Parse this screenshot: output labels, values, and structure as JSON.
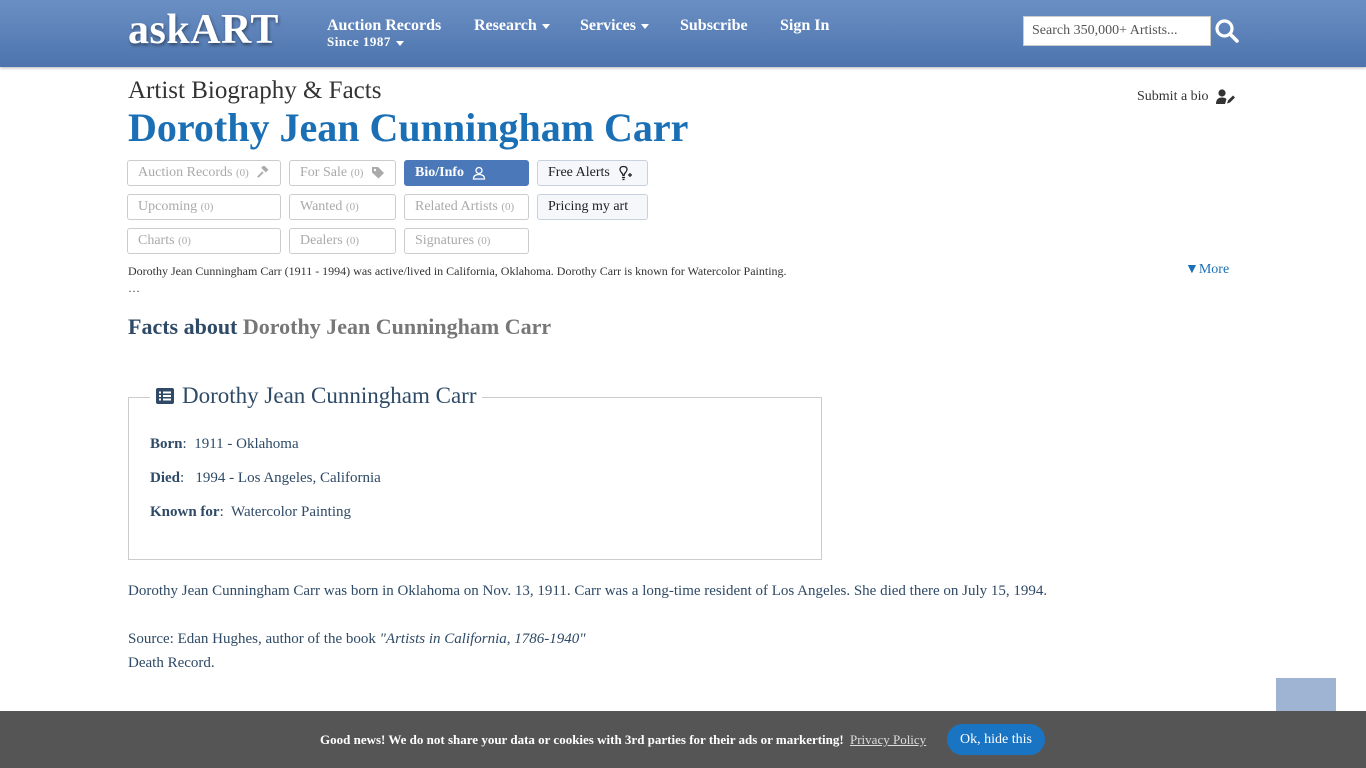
{
  "header": {
    "logo": "askART",
    "nav": {
      "auction_records": "Auction Records",
      "auction_records_sub": "Since 1987",
      "research": "Research",
      "services": "Services",
      "subscribe": "Subscribe",
      "sign_in": "Sign In"
    },
    "search": {
      "placeholder": "Search 350,000+ Artists..."
    }
  },
  "page": {
    "subtitle": "Artist Biography & Facts",
    "artist_name": "Dorothy Jean Cunningham Carr",
    "submit_bio": "Submit a bio"
  },
  "tabs": {
    "auction_records": {
      "label": "Auction Records",
      "count": "(0)"
    },
    "for_sale": {
      "label": "For Sale",
      "count": "(0)"
    },
    "bio_info": {
      "label": "Bio/Info"
    },
    "free_alerts": {
      "label": "Free Alerts"
    },
    "upcoming": {
      "label": "Upcoming",
      "count": "(0)"
    },
    "wanted": {
      "label": "Wanted",
      "count": "(0)"
    },
    "related_artists": {
      "label": "Related Artists",
      "count": "(0)"
    },
    "pricing": {
      "label": "Pricing my art"
    },
    "charts": {
      "label": "Charts",
      "count": "(0)"
    },
    "dealers": {
      "label": "Dealers",
      "count": "(0)"
    },
    "signatures": {
      "label": "Signatures",
      "count": "(0)"
    }
  },
  "summary": {
    "text": "Dorothy Jean Cunningham Carr (1911 - 1994) was active/lived in California, Oklahoma.  Dorothy Carr is known for Watercolor Painting.",
    "ellipsis": "…",
    "more": "▼More"
  },
  "facts": {
    "heading_prefix": "Facts about",
    "heading_name": "Dorothy Jean Cunningham Carr",
    "box_title": "Dorothy Jean Cunningham Carr",
    "born_label": "Born",
    "born_value": "1911 - Oklahoma",
    "died_label": "Died",
    "died_value": "1994 - Los Angeles, California",
    "known_label": "Known for",
    "known_value": "Watercolor Painting"
  },
  "bio": {
    "text": "Dorothy Jean Cunningham Carr was born in Oklahoma on Nov. 13, 1911.  Carr was a long-time resident of Los Angeles.  She died there on July 15, 1994.",
    "source_prefix": "Source: Edan Hughes, author of the book ",
    "source_book": "\"Artists in California, 1786-1940\"",
    "death_record": "Death Record."
  },
  "cookie": {
    "message": "Good news! We do not share your data or cookies with 3rd parties for their ads or markerting!",
    "policy_link": "Privacy Policy",
    "button": "Ok, hide this"
  },
  "colors": {
    "header_top": "#6a8fc4",
    "header_bottom": "#4d74ad",
    "accent": "#1a6fb5",
    "active_tab": "#4a78b8",
    "text_dark": "#2e4a66",
    "cookie_bar": "#555555",
    "cookie_button": "#1a74c4"
  }
}
